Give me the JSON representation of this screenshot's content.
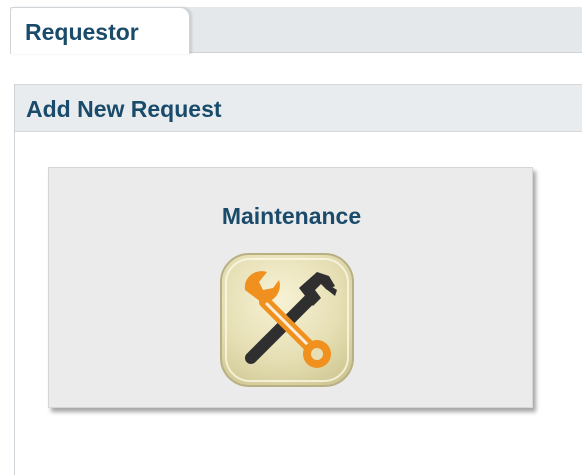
{
  "tabs": [
    {
      "label": "Requestor"
    }
  ],
  "panel": {
    "title": "Add New Request"
  },
  "request_types": [
    {
      "label": "Maintenance",
      "icon": "wrench-hammer-icon"
    }
  ],
  "colors": {
    "heading_text": "#1b4b6b",
    "tab_bar": "#e5e8ea",
    "panel_header": "#e8ecef",
    "card_background": "#ebebeb",
    "icon_accent": "#f0901e",
    "icon_tile": "#e7e0b6"
  }
}
